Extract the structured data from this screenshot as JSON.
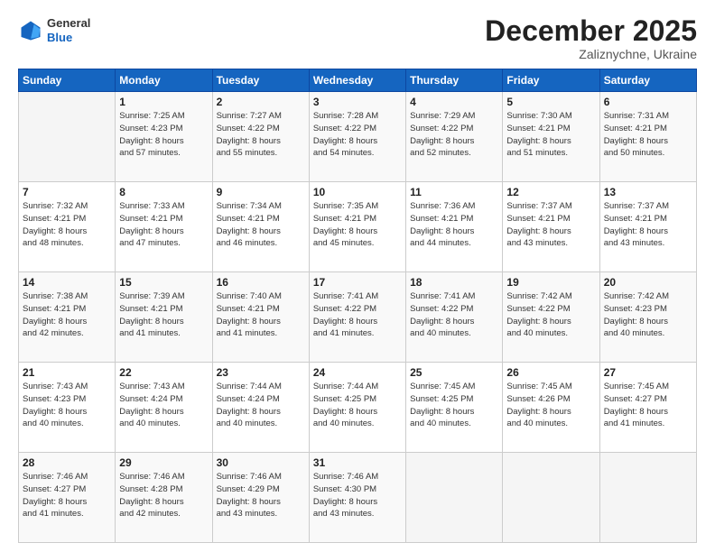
{
  "logo": {
    "general": "General",
    "blue": "Blue"
  },
  "header": {
    "month": "December 2025",
    "location": "Zaliznychne, Ukraine"
  },
  "weekdays": [
    "Sunday",
    "Monday",
    "Tuesday",
    "Wednesday",
    "Thursday",
    "Friday",
    "Saturday"
  ],
  "weeks": [
    [
      {
        "day": "",
        "info": ""
      },
      {
        "day": "1",
        "info": "Sunrise: 7:25 AM\nSunset: 4:23 PM\nDaylight: 8 hours\nand 57 minutes."
      },
      {
        "day": "2",
        "info": "Sunrise: 7:27 AM\nSunset: 4:22 PM\nDaylight: 8 hours\nand 55 minutes."
      },
      {
        "day": "3",
        "info": "Sunrise: 7:28 AM\nSunset: 4:22 PM\nDaylight: 8 hours\nand 54 minutes."
      },
      {
        "day": "4",
        "info": "Sunrise: 7:29 AM\nSunset: 4:22 PM\nDaylight: 8 hours\nand 52 minutes."
      },
      {
        "day": "5",
        "info": "Sunrise: 7:30 AM\nSunset: 4:21 PM\nDaylight: 8 hours\nand 51 minutes."
      },
      {
        "day": "6",
        "info": "Sunrise: 7:31 AM\nSunset: 4:21 PM\nDaylight: 8 hours\nand 50 minutes."
      }
    ],
    [
      {
        "day": "7",
        "info": "Sunrise: 7:32 AM\nSunset: 4:21 PM\nDaylight: 8 hours\nand 48 minutes."
      },
      {
        "day": "8",
        "info": "Sunrise: 7:33 AM\nSunset: 4:21 PM\nDaylight: 8 hours\nand 47 minutes."
      },
      {
        "day": "9",
        "info": "Sunrise: 7:34 AM\nSunset: 4:21 PM\nDaylight: 8 hours\nand 46 minutes."
      },
      {
        "day": "10",
        "info": "Sunrise: 7:35 AM\nSunset: 4:21 PM\nDaylight: 8 hours\nand 45 minutes."
      },
      {
        "day": "11",
        "info": "Sunrise: 7:36 AM\nSunset: 4:21 PM\nDaylight: 8 hours\nand 44 minutes."
      },
      {
        "day": "12",
        "info": "Sunrise: 7:37 AM\nSunset: 4:21 PM\nDaylight: 8 hours\nand 43 minutes."
      },
      {
        "day": "13",
        "info": "Sunrise: 7:37 AM\nSunset: 4:21 PM\nDaylight: 8 hours\nand 43 minutes."
      }
    ],
    [
      {
        "day": "14",
        "info": "Sunrise: 7:38 AM\nSunset: 4:21 PM\nDaylight: 8 hours\nand 42 minutes."
      },
      {
        "day": "15",
        "info": "Sunrise: 7:39 AM\nSunset: 4:21 PM\nDaylight: 8 hours\nand 41 minutes."
      },
      {
        "day": "16",
        "info": "Sunrise: 7:40 AM\nSunset: 4:21 PM\nDaylight: 8 hours\nand 41 minutes."
      },
      {
        "day": "17",
        "info": "Sunrise: 7:41 AM\nSunset: 4:22 PM\nDaylight: 8 hours\nand 41 minutes."
      },
      {
        "day": "18",
        "info": "Sunrise: 7:41 AM\nSunset: 4:22 PM\nDaylight: 8 hours\nand 40 minutes."
      },
      {
        "day": "19",
        "info": "Sunrise: 7:42 AM\nSunset: 4:22 PM\nDaylight: 8 hours\nand 40 minutes."
      },
      {
        "day": "20",
        "info": "Sunrise: 7:42 AM\nSunset: 4:23 PM\nDaylight: 8 hours\nand 40 minutes."
      }
    ],
    [
      {
        "day": "21",
        "info": "Sunrise: 7:43 AM\nSunset: 4:23 PM\nDaylight: 8 hours\nand 40 minutes."
      },
      {
        "day": "22",
        "info": "Sunrise: 7:43 AM\nSunset: 4:24 PM\nDaylight: 8 hours\nand 40 minutes."
      },
      {
        "day": "23",
        "info": "Sunrise: 7:44 AM\nSunset: 4:24 PM\nDaylight: 8 hours\nand 40 minutes."
      },
      {
        "day": "24",
        "info": "Sunrise: 7:44 AM\nSunset: 4:25 PM\nDaylight: 8 hours\nand 40 minutes."
      },
      {
        "day": "25",
        "info": "Sunrise: 7:45 AM\nSunset: 4:25 PM\nDaylight: 8 hours\nand 40 minutes."
      },
      {
        "day": "26",
        "info": "Sunrise: 7:45 AM\nSunset: 4:26 PM\nDaylight: 8 hours\nand 40 minutes."
      },
      {
        "day": "27",
        "info": "Sunrise: 7:45 AM\nSunset: 4:27 PM\nDaylight: 8 hours\nand 41 minutes."
      }
    ],
    [
      {
        "day": "28",
        "info": "Sunrise: 7:46 AM\nSunset: 4:27 PM\nDaylight: 8 hours\nand 41 minutes."
      },
      {
        "day": "29",
        "info": "Sunrise: 7:46 AM\nSunset: 4:28 PM\nDaylight: 8 hours\nand 42 minutes."
      },
      {
        "day": "30",
        "info": "Sunrise: 7:46 AM\nSunset: 4:29 PM\nDaylight: 8 hours\nand 43 minutes."
      },
      {
        "day": "31",
        "info": "Sunrise: 7:46 AM\nSunset: 4:30 PM\nDaylight: 8 hours\nand 43 minutes."
      },
      {
        "day": "",
        "info": ""
      },
      {
        "day": "",
        "info": ""
      },
      {
        "day": "",
        "info": ""
      }
    ]
  ]
}
